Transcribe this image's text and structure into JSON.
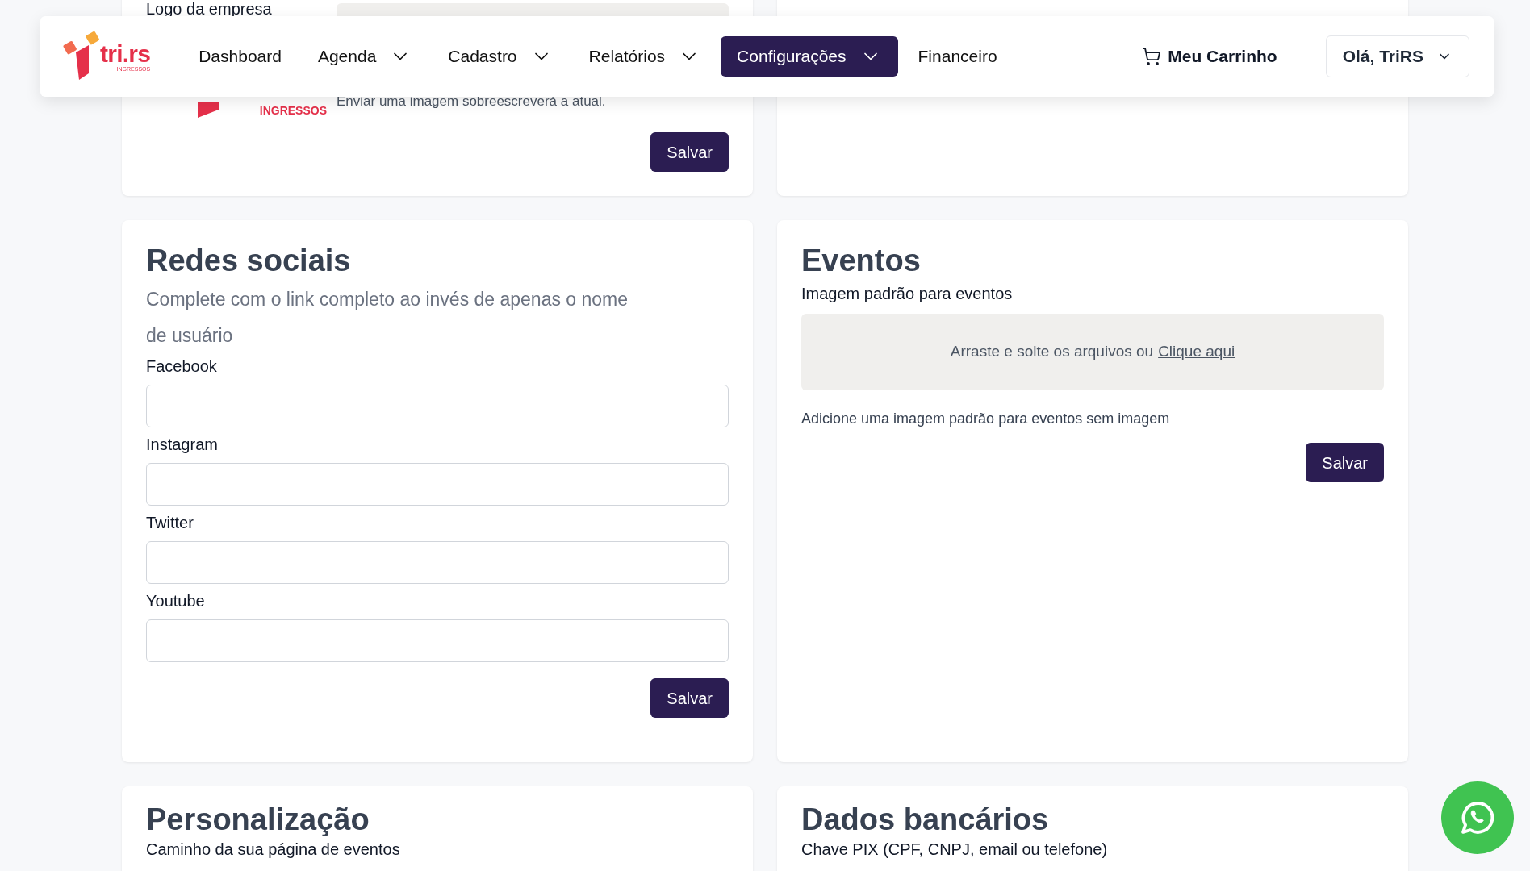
{
  "navbar": {
    "logo": {
      "name": "tri.rs",
      "tagline": "INGRESSOS"
    },
    "items": [
      {
        "label": "Dashboard",
        "dropdown": false,
        "selected": false
      },
      {
        "label": "Agenda",
        "dropdown": true,
        "selected": false
      },
      {
        "label": "Cadastro",
        "dropdown": true,
        "selected": false
      },
      {
        "label": "Relatórios",
        "dropdown": true,
        "selected": false
      },
      {
        "label": "Configurações",
        "dropdown": true,
        "selected": true
      },
      {
        "label": "Financeiro",
        "dropdown": false,
        "selected": false
      }
    ],
    "cart": "Meu Carrinho",
    "user_menu": "Olá, TriRS"
  },
  "logo_card": {
    "label": "Logo da empresa",
    "logo_tagline": "INGRESSOS",
    "help": "Enviar uma imagem sobreescreverá a atual.",
    "button": "Salvar"
  },
  "social_card": {
    "title": "Redes sociais",
    "subtitle": "Complete com o link completo ao invés de apenas o nome de usuário",
    "fields": [
      {
        "label": "Facebook"
      },
      {
        "label": "Instagram"
      },
      {
        "label": "Twitter"
      },
      {
        "label": "Youtube"
      }
    ],
    "button": "Salvar"
  },
  "events_card": {
    "title": "Eventos",
    "label": "Imagem padrão para eventos",
    "dropzone_text": "Arraste e solte os arquivos ou",
    "dropzone_link": "Clique aqui",
    "help": "Adicione uma imagem padrão para eventos sem imagem",
    "button": "Salvar"
  },
  "custom_card": {
    "title": "Personalização",
    "label": "Caminho da sua página de eventos"
  },
  "bank_card": {
    "title": "Dados bancários",
    "label": "Chave PIX (CPF, CNPJ, email ou telefone)"
  }
}
